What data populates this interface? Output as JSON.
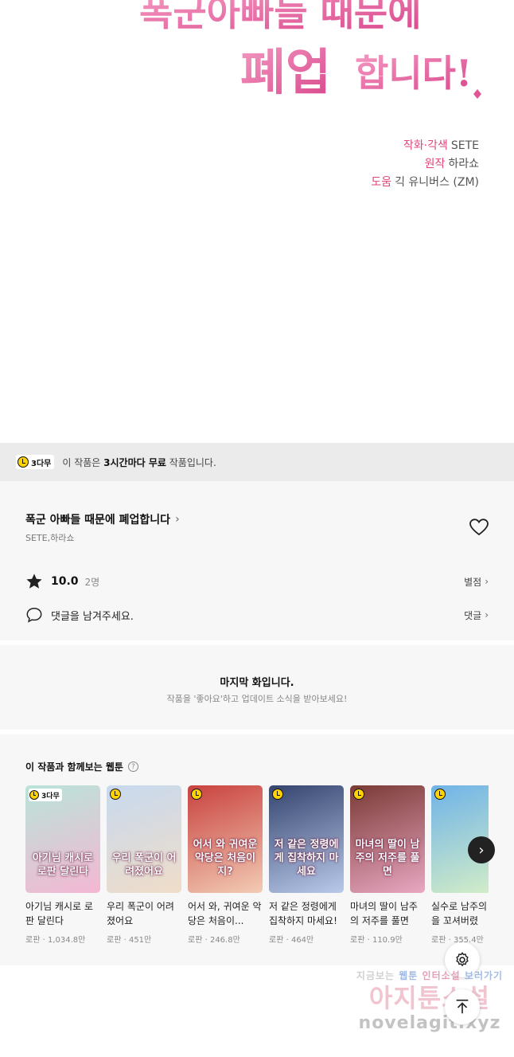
{
  "comic": {
    "title_line1": "폭군아빠들 때문에",
    "title_line2": "폐업",
    "title_line3": "합니다!",
    "credits": [
      {
        "role": "작화·각색",
        "name": "SETE"
      },
      {
        "role": "원작",
        "name": "하라쇼"
      },
      {
        "role": "도움",
        "name": "긱 유니버스 (ZM)"
      }
    ]
  },
  "free_banner": {
    "badge": "3다무",
    "text_prefix": "이 작품은 ",
    "text_bold": "3시간마다 무료",
    "text_suffix": " 작품입니다."
  },
  "series": {
    "title": "폭군 아빠들 때문에 폐업합니다",
    "authors": "SETE,하라쇼",
    "rating": "10.0",
    "rating_count": "2명",
    "rating_link": "별점",
    "comment_placeholder": "댓글을 남겨주세요.",
    "comment_link": "댓글"
  },
  "last_episode": {
    "title": "마지막 화입니다.",
    "subtitle": "작품을 '좋아요'하고 업데이트 소식을 받아보세요!"
  },
  "recommendations": {
    "title": "이 작품과 함께보는 웹툰",
    "items": [
      {
        "name": "아기님 캐시로 로판 달린다",
        "genre": "로판",
        "views": "1,034.8만",
        "cover_text": "아기님 캐시로 로판 달린다",
        "badge": "3다무",
        "colors": [
          "#b9e4d9",
          "#f4b7d3"
        ]
      },
      {
        "name": "우리 폭군이 어려졌어요",
        "genre": "로판",
        "views": "451만",
        "cover_text": "우리 폭군이 어려졌어요",
        "badge": "",
        "colors": [
          "#c7d9ef",
          "#f0ddc8"
        ]
      },
      {
        "name": "어서 와, 귀여운 악당은 처음이...",
        "genre": "로판",
        "views": "246.8만",
        "cover_text": "어서 와 귀여운 악당은 처음이지?",
        "badge": "",
        "colors": [
          "#c9423f",
          "#f2cbb4"
        ]
      },
      {
        "name": "저 같은 정령에게 집착하지 마세요!",
        "genre": "로판",
        "views": "464만",
        "cover_text": "저 같은 정령에게 집착하지 마세요",
        "badge": "",
        "colors": [
          "#34446e",
          "#b9c9ea"
        ]
      },
      {
        "name": "마녀의 딸이 남주의 저주를 풀면",
        "genre": "로판",
        "views": "110.9만",
        "cover_text": "마녀의 딸이 남주의 저주를 풀면",
        "badge": "",
        "colors": [
          "#7a3a35",
          "#e9a7c2"
        ]
      },
      {
        "name": "실수로 남주의 생을 꼬셔버렸",
        "genre": "로판",
        "views": "355.4만",
        "cover_text": "",
        "badge": "",
        "colors": [
          "#6fb3e8",
          "#d6efc6"
        ]
      }
    ]
  },
  "watermark": {
    "line1_a": "지금보는",
    "line1_b": "웹툰",
    "line1_c": "인터소설",
    "line1_d": "보러가기",
    "line2": "아지툰소설",
    "line3": "novelagit.xyz"
  },
  "colors": {
    "accent_pink": "#e0457b",
    "free_yellow": "#ffd200"
  }
}
